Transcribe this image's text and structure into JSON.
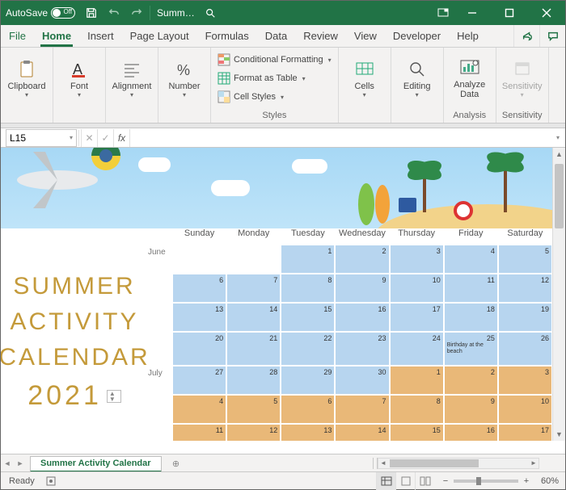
{
  "titlebar": {
    "autosave_label": "AutoSave",
    "autosave_state": "Off",
    "doc_title": "Summ…"
  },
  "tabs": {
    "file": "File",
    "home": "Home",
    "insert": "Insert",
    "page_layout": "Page Layout",
    "formulas": "Formulas",
    "data": "Data",
    "review": "Review",
    "view": "View",
    "developer": "Developer",
    "help": "Help"
  },
  "ribbon": {
    "clipboard": "Clipboard",
    "font": "Font",
    "alignment": "Alignment",
    "number": "Number",
    "styles_label": "Styles",
    "cond_fmt": "Conditional Formatting",
    "fmt_table": "Format as Table",
    "cell_styles": "Cell Styles",
    "cells": "Cells",
    "editing": "Editing",
    "analyze": "Analyze Data",
    "sensitivity": "Sensitivity"
  },
  "formula_bar": {
    "cell_ref": "L15",
    "formula": ""
  },
  "calendar": {
    "title_words": [
      "SUMMER",
      "ACTIVITY",
      "CALENDAR"
    ],
    "year": "2021",
    "days": [
      "Sunday",
      "Monday",
      "Tuesday",
      "Wednesday",
      "Thursday",
      "Friday",
      "Saturday"
    ],
    "months": {
      "june": "June",
      "july": "July"
    },
    "rows": [
      {
        "month_label": "June",
        "cells": [
          {
            "n": "",
            "cls": "blank"
          },
          {
            "n": "",
            "cls": "blank"
          },
          {
            "n": "1",
            "cls": "june"
          },
          {
            "n": "2",
            "cls": "june"
          },
          {
            "n": "3",
            "cls": "june"
          },
          {
            "n": "4",
            "cls": "june"
          },
          {
            "n": "5",
            "cls": "june"
          }
        ]
      },
      {
        "month_label": "",
        "cells": [
          {
            "n": "6",
            "cls": "june"
          },
          {
            "n": "7",
            "cls": "june"
          },
          {
            "n": "8",
            "cls": "june"
          },
          {
            "n": "9",
            "cls": "june"
          },
          {
            "n": "10",
            "cls": "june"
          },
          {
            "n": "11",
            "cls": "june"
          },
          {
            "n": "12",
            "cls": "june"
          }
        ]
      },
      {
        "month_label": "",
        "cells": [
          {
            "n": "13",
            "cls": "june"
          },
          {
            "n": "14",
            "cls": "june"
          },
          {
            "n": "15",
            "cls": "june"
          },
          {
            "n": "16",
            "cls": "june"
          },
          {
            "n": "17",
            "cls": "june"
          },
          {
            "n": "18",
            "cls": "june"
          },
          {
            "n": "19",
            "cls": "june"
          }
        ]
      },
      {
        "month_label": "",
        "tall": true,
        "cells": [
          {
            "n": "20",
            "cls": "june"
          },
          {
            "n": "21",
            "cls": "june"
          },
          {
            "n": "22",
            "cls": "june"
          },
          {
            "n": "23",
            "cls": "june"
          },
          {
            "n": "24",
            "cls": "june"
          },
          {
            "n": "25",
            "cls": "june",
            "note": "Birthday at the beach"
          },
          {
            "n": "26",
            "cls": "june"
          }
        ]
      },
      {
        "month_label": "July",
        "cells": [
          {
            "n": "27",
            "cls": "june"
          },
          {
            "n": "28",
            "cls": "june"
          },
          {
            "n": "29",
            "cls": "june"
          },
          {
            "n": "30",
            "cls": "june"
          },
          {
            "n": "1",
            "cls": "july"
          },
          {
            "n": "2",
            "cls": "july"
          },
          {
            "n": "3",
            "cls": "july"
          }
        ]
      },
      {
        "month_label": "",
        "cells": [
          {
            "n": "4",
            "cls": "july"
          },
          {
            "n": "5",
            "cls": "july"
          },
          {
            "n": "6",
            "cls": "july"
          },
          {
            "n": "7",
            "cls": "july"
          },
          {
            "n": "8",
            "cls": "july"
          },
          {
            "n": "9",
            "cls": "july"
          },
          {
            "n": "10",
            "cls": "july"
          }
        ]
      },
      {
        "month_label": "",
        "cells": [
          {
            "n": "11",
            "cls": "july"
          },
          {
            "n": "12",
            "cls": "july"
          },
          {
            "n": "13",
            "cls": "july"
          },
          {
            "n": "14",
            "cls": "july"
          },
          {
            "n": "15",
            "cls": "july"
          },
          {
            "n": "16",
            "cls": "july"
          },
          {
            "n": "17",
            "cls": "july"
          }
        ]
      }
    ]
  },
  "sheet_tab": "Summer Activity Calendar",
  "statusbar": {
    "ready": "Ready",
    "zoom": "60%"
  }
}
